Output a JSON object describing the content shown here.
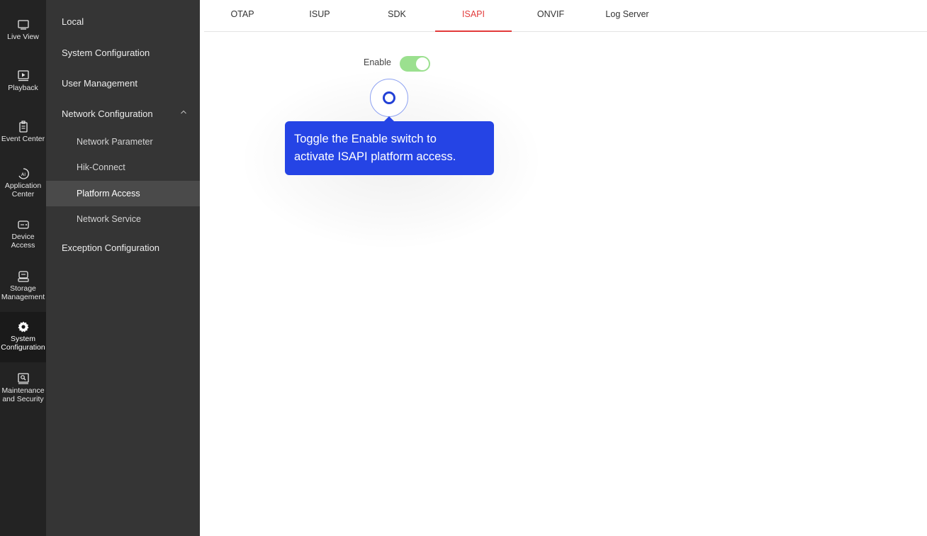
{
  "rail": {
    "items": [
      {
        "label": "Live View",
        "icon": "monitor-icon"
      },
      {
        "label": "Playback",
        "icon": "playback-icon"
      },
      {
        "label": "Event Center",
        "icon": "clipboard-icon"
      },
      {
        "label": "Application Center",
        "icon": "ai-icon"
      },
      {
        "label": "Device Access",
        "icon": "device-icon"
      },
      {
        "label": "Storage Management",
        "icon": "storage-icon"
      },
      {
        "label": "System Configuration",
        "icon": "gear-icon"
      },
      {
        "label": "Maintenance and Security",
        "icon": "maintenance-icon"
      }
    ],
    "active_index": 6
  },
  "menu": {
    "local": "Local",
    "system_configuration": "System Configuration",
    "user_management": "User Management",
    "network_configuration": "Network Configuration",
    "network_parameter": "Network Parameter",
    "hik_connect": "Hik-Connect",
    "platform_access": "Platform Access",
    "network_service": "Network Service",
    "exception_configuration": "Exception Configuration",
    "expand_icon": "chevron-up-icon"
  },
  "tabs": {
    "items": [
      "OTAP",
      "ISUP",
      "SDK",
      "ISAPI",
      "ONVIF",
      "Log Server"
    ],
    "active": "ISAPI"
  },
  "content": {
    "enable_label": "Enable",
    "enable_state": true
  },
  "tooltip": {
    "line1": "Toggle the Enable switch to",
    "line2": "activate ISAPI platform access."
  },
  "colors": {
    "accent_tab": "#e23b3b",
    "switch_on": "#9be08f",
    "tooltip_bg": "#2544e5"
  }
}
